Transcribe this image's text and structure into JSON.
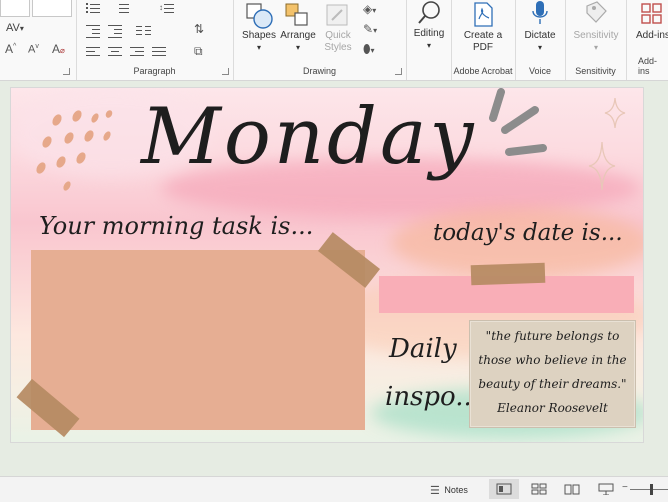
{
  "ribbon": {
    "paragraph_label": "Paragraph",
    "drawing": {
      "label": "Drawing",
      "shapes_label": "Shapes",
      "arrange_label": "Arrange",
      "quick_styles_label": "Quick Styles"
    },
    "editing_label": "Editing",
    "acrobat": {
      "label": "Adobe Acrobat",
      "create_pdf_label": "Create a PDF"
    },
    "voice": {
      "label": "Voice",
      "dictate_label": "Dictate"
    },
    "sensitivity": {
      "label": "Sensitivity",
      "button_label": "Sensitivity"
    },
    "addins": {
      "label": "Add-ins",
      "button_label": "Add-ins"
    }
  },
  "slide": {
    "title": "Monday",
    "task_heading": "Your morning task is...",
    "date_heading": "today's date is...",
    "inspo_heading_line1": "Daily",
    "inspo_heading_line2": "inspo...",
    "quote_line1": "\"the future belongs to",
    "quote_line2": "those who believe in the",
    "quote_line3": "beauty of their dreams.\"",
    "quote_author": "Eleanor Roosevelt",
    "colors": {
      "task_box": "#e6ae93",
      "date_bar": "#f9aeb7",
      "tape": "#b58a62",
      "paper": "#ddd2c1"
    }
  },
  "statusbar": {
    "notes_label": "Notes"
  }
}
